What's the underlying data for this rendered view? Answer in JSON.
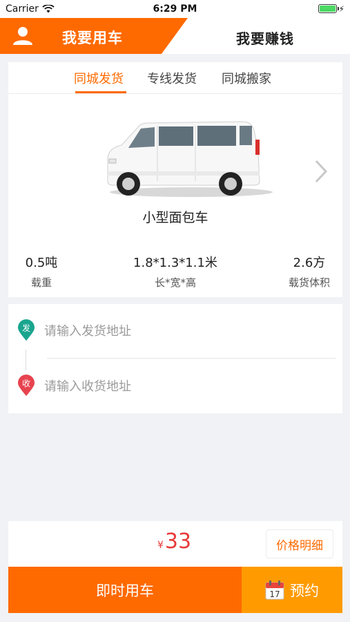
{
  "status_bar": {
    "carrier": "Carrier",
    "time": "6:29 PM"
  },
  "header": {
    "left_label": "我要用车",
    "right_label": "我要赚钱",
    "accent_color": "#ff6a00"
  },
  "tabs": [
    {
      "label": "同城发货",
      "active": true
    },
    {
      "label": "专线发货",
      "active": false
    },
    {
      "label": "同城搬家",
      "active": false
    }
  ],
  "vehicle": {
    "name": "小型面包车",
    "specs": [
      {
        "value": "0.5吨",
        "label": "载重"
      },
      {
        "value": "1.8*1.3*1.1米",
        "label": "长*宽*高"
      },
      {
        "value": "2.6方",
        "label": "载货体积"
      }
    ]
  },
  "address": {
    "from_marker": "发",
    "from_placeholder": "请输入发货地址",
    "to_marker": "收",
    "to_placeholder": "请输入收货地址"
  },
  "price": {
    "currency": "¥",
    "amount": "33",
    "detail_label": "价格明细"
  },
  "actions": {
    "now_label": "即时用车",
    "book_label": "预约",
    "calendar_day": "17"
  }
}
